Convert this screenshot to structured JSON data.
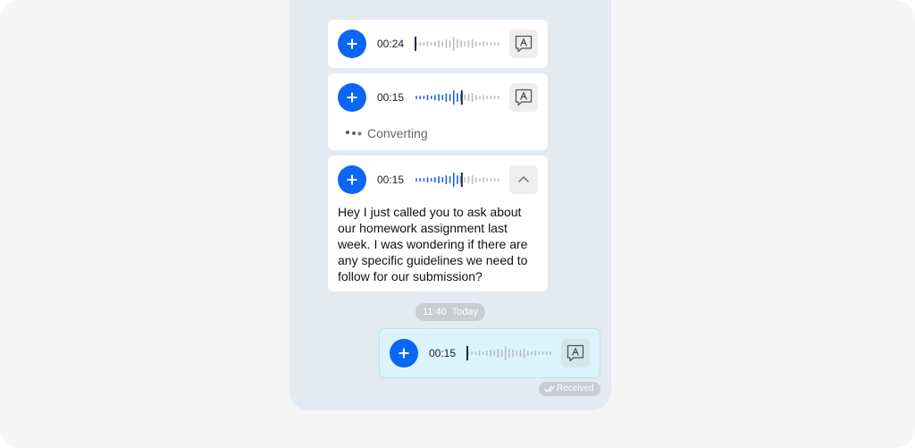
{
  "colors": {
    "accent": "#0a66f5",
    "played_wave": "#1a63d6",
    "unplayed_wave": "#b8bcc4",
    "playhead": "#1b2a44",
    "sent_bubble": "#dcf3fc",
    "phone_bg": "#e4eaf2"
  },
  "messages": [
    {
      "duration": "00:24",
      "progress": 0,
      "state": "idle",
      "side_button_icon": "transcribe-icon"
    },
    {
      "duration": "00:15",
      "progress": 0.55,
      "state": "converting",
      "converting_label": "Converting",
      "side_button_icon": "transcribe-icon"
    },
    {
      "duration": "00:15",
      "progress": 0.55,
      "state": "transcribed",
      "side_button_icon": "chevron-up-icon",
      "transcript": "Hey I just called you to ask about our homework assignment last week. I was wondering if there are any specific guidelines we need to follow for our submission?"
    }
  ],
  "timestamp": {
    "time": "11:40",
    "day": "Today"
  },
  "sent_message": {
    "duration": "00:15",
    "progress": 0,
    "side_button_icon": "transcribe-icon",
    "status_label": "Received",
    "status_icon": "double-check-icon"
  }
}
